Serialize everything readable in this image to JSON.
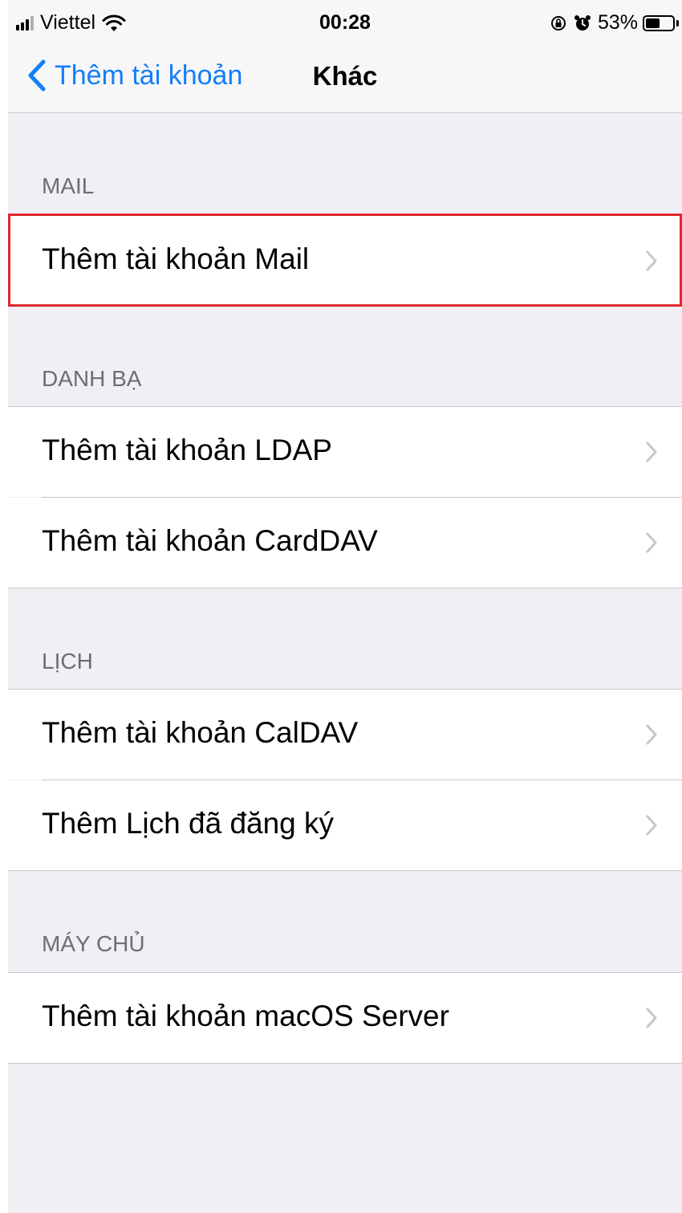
{
  "status_bar": {
    "carrier": "Viettel",
    "time": "00:28",
    "battery_percent": "53%",
    "battery_level": 0.53,
    "icons": [
      "signal-icon",
      "wifi-icon",
      "orientation-lock-icon",
      "alarm-icon",
      "battery-icon"
    ]
  },
  "nav": {
    "back_label": "Thêm tài khoản",
    "title": "Khác"
  },
  "sections": [
    {
      "header": "MAIL",
      "items": [
        {
          "label": "Thêm tài khoản Mail",
          "highlighted": true
        }
      ]
    },
    {
      "header": "DANH BẠ",
      "items": [
        {
          "label": "Thêm tài khoản LDAP"
        },
        {
          "label": "Thêm tài khoản CardDAV"
        }
      ]
    },
    {
      "header": "LỊCH",
      "items": [
        {
          "label": "Thêm tài khoản CalDAV"
        },
        {
          "label": "Thêm Lịch đã đăng ký"
        }
      ]
    },
    {
      "header": "MÁY CHỦ",
      "items": [
        {
          "label": "Thêm tài khoản macOS Server"
        }
      ]
    }
  ],
  "colors": {
    "accent": "#147efb",
    "background": "#efeff4",
    "highlight": "#e0282e"
  }
}
